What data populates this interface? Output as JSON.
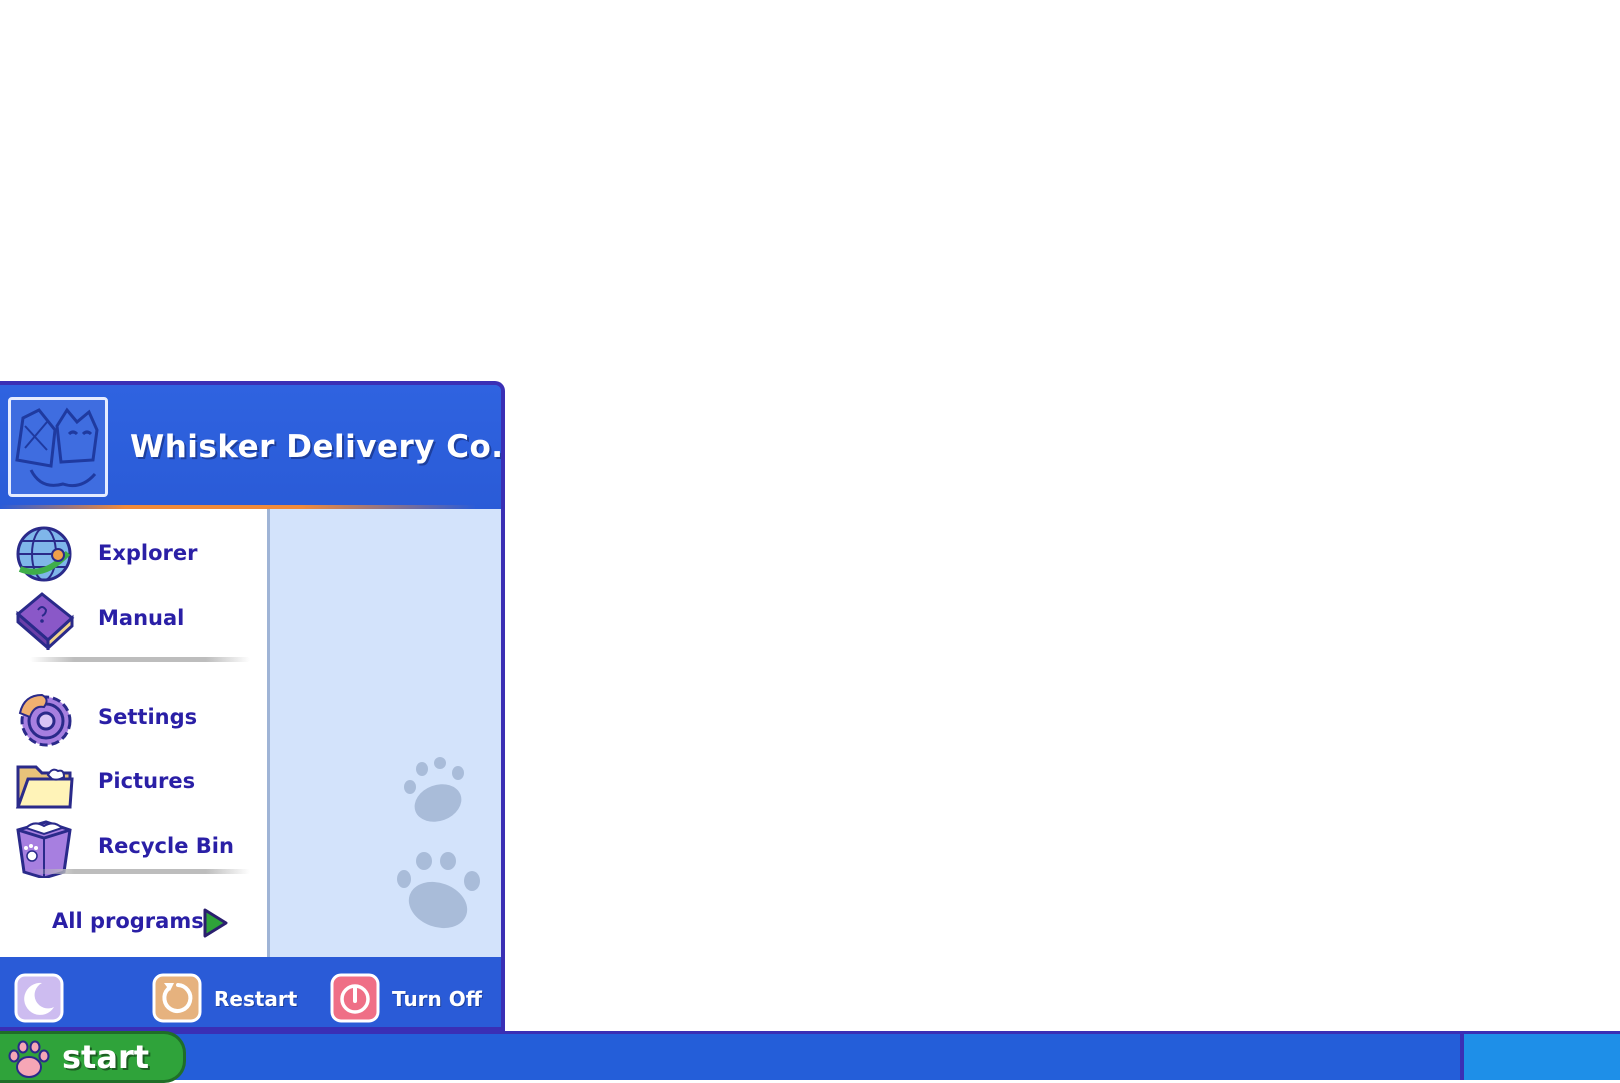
{
  "start_menu": {
    "user_name": "Whisker Delivery Co.",
    "items": [
      {
        "label": "Explorer",
        "icon": "globe-icon"
      },
      {
        "label": "Manual",
        "icon": "book-icon"
      },
      {
        "label": "Settings",
        "icon": "gear-icon"
      },
      {
        "label": "Pictures",
        "icon": "folder-icon"
      },
      {
        "label": "Recycle Bin",
        "icon": "trash-icon"
      }
    ],
    "all_programs_label": "All programs",
    "footer": {
      "sleep_icon": "moon-icon",
      "restart_label": "Restart",
      "turn_off_label": "Turn Off"
    }
  },
  "taskbar": {
    "start_label": "start",
    "start_icon": "paw-icon"
  },
  "colors": {
    "accent_blue": "#2a5bd7",
    "border_purple": "#3a2fb5",
    "start_green": "#2fa33a",
    "menu_text": "#2a1fa6",
    "pane_light_blue": "#d3e3fb"
  }
}
